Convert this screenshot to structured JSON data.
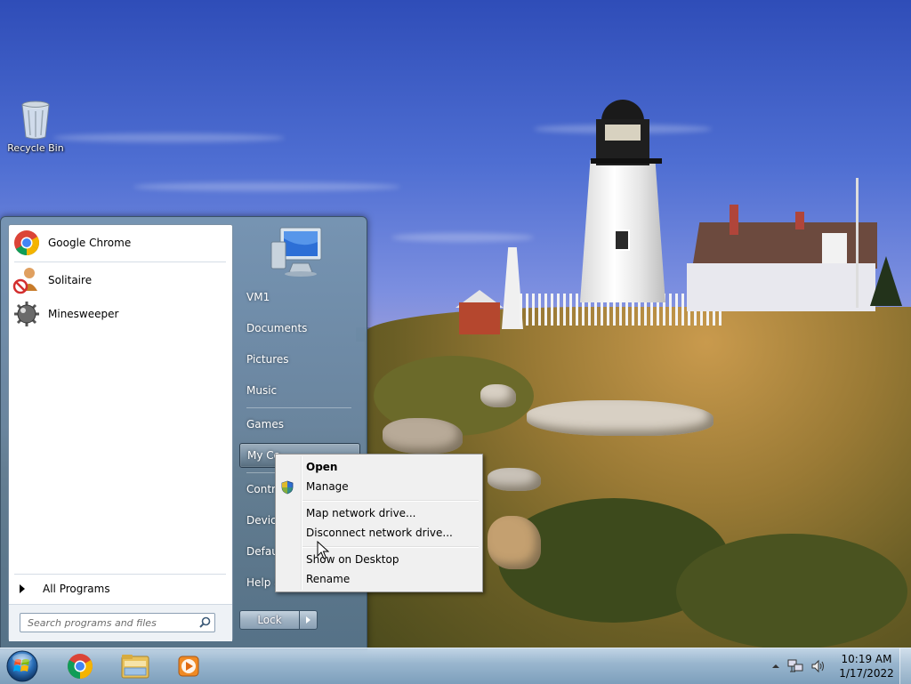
{
  "desktop": {
    "icons": [
      {
        "label": "Recycle Bin",
        "icon": "recycle-bin-icon"
      }
    ]
  },
  "start_menu": {
    "pinned_programs": [
      {
        "label": "Google Chrome",
        "icon": "chrome-icon"
      },
      {
        "label": "Solitaire",
        "icon": "solitaire-icon"
      },
      {
        "label": "Minesweeper",
        "icon": "minesweeper-icon"
      }
    ],
    "all_programs_label": "All Programs",
    "search_placeholder": "Search programs and files",
    "right_items": [
      {
        "label": "VM1"
      },
      {
        "label": "Documents"
      },
      {
        "label": "Pictures"
      },
      {
        "label": "Music"
      },
      {
        "label": "Games"
      },
      {
        "label": "My Co",
        "active": true
      },
      {
        "label": "Contro"
      },
      {
        "label": "Device"
      },
      {
        "label": "Defaul"
      },
      {
        "label": "Help a"
      }
    ],
    "lock_label": "Lock"
  },
  "context_menu": {
    "items": [
      {
        "label": "Open",
        "bold": true
      },
      {
        "label": "Manage",
        "icon": "uac-shield-icon"
      },
      {
        "label": "Map network drive..."
      },
      {
        "label": "Disconnect network drive..."
      },
      {
        "label": "Show on Desktop"
      },
      {
        "label": "Rename"
      }
    ]
  },
  "taskbar": {
    "pinned": [
      {
        "icon": "start-orb-icon"
      },
      {
        "icon": "chrome-icon"
      },
      {
        "icon": "windows-explorer-icon"
      },
      {
        "icon": "media-player-icon"
      }
    ],
    "tray_icons": [
      "show-hidden-icons-chevron",
      "network-icon",
      "volume-icon"
    ],
    "clock": {
      "time": "10:19 AM",
      "date": "1/17/2022"
    }
  },
  "colors": {
    "start_menu_glass": "#6f8fab",
    "taskbar_glass": "#9fb9d0",
    "context_menu_bg": "#f0f0f0"
  }
}
